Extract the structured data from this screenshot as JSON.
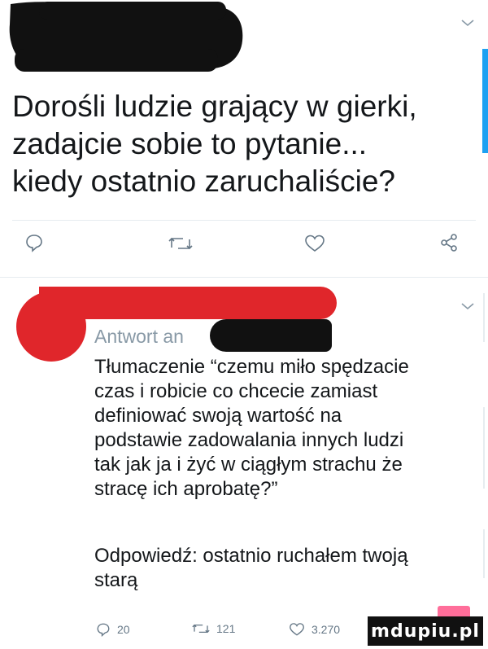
{
  "tweet": {
    "text_lines": [
      "Dorośli ludzie grający w gierki,",
      "zadajcie sobie to pytanie...",
      "kiedy ostatnio zaruchaliście?"
    ]
  },
  "icons": [
    "chevron-down-icon",
    "reply-icon",
    "retweet-icon",
    "like-icon",
    "share-icon",
    "avatar"
  ],
  "reply": {
    "in_reply_to_prefix": "Antwort an",
    "text_lines": [
      "Tłumaczenie “czemu miło spędzacie",
      "czas i robicie co chcecie zamiast",
      "definiować swoją wartość na",
      "podstawie zadowalania innych ludzi",
      "tak jak ja i żyć w ciągłym strachu że",
      "stracę ich aprobatę?”"
    ],
    "answer_lines": [
      "Odpowiedź: ostatnio ruchałem twoją",
      "starą"
    ],
    "stats": {
      "replies": "20",
      "retweets": "121",
      "likes": "3.270"
    }
  },
  "colors": {
    "accent": "#1da1f2",
    "redaction_red": "#e0262b",
    "redaction_black": "#111111",
    "watermark_pink": "#ff6e9a"
  },
  "watermark": {
    "text": "mdupiu.pl"
  }
}
